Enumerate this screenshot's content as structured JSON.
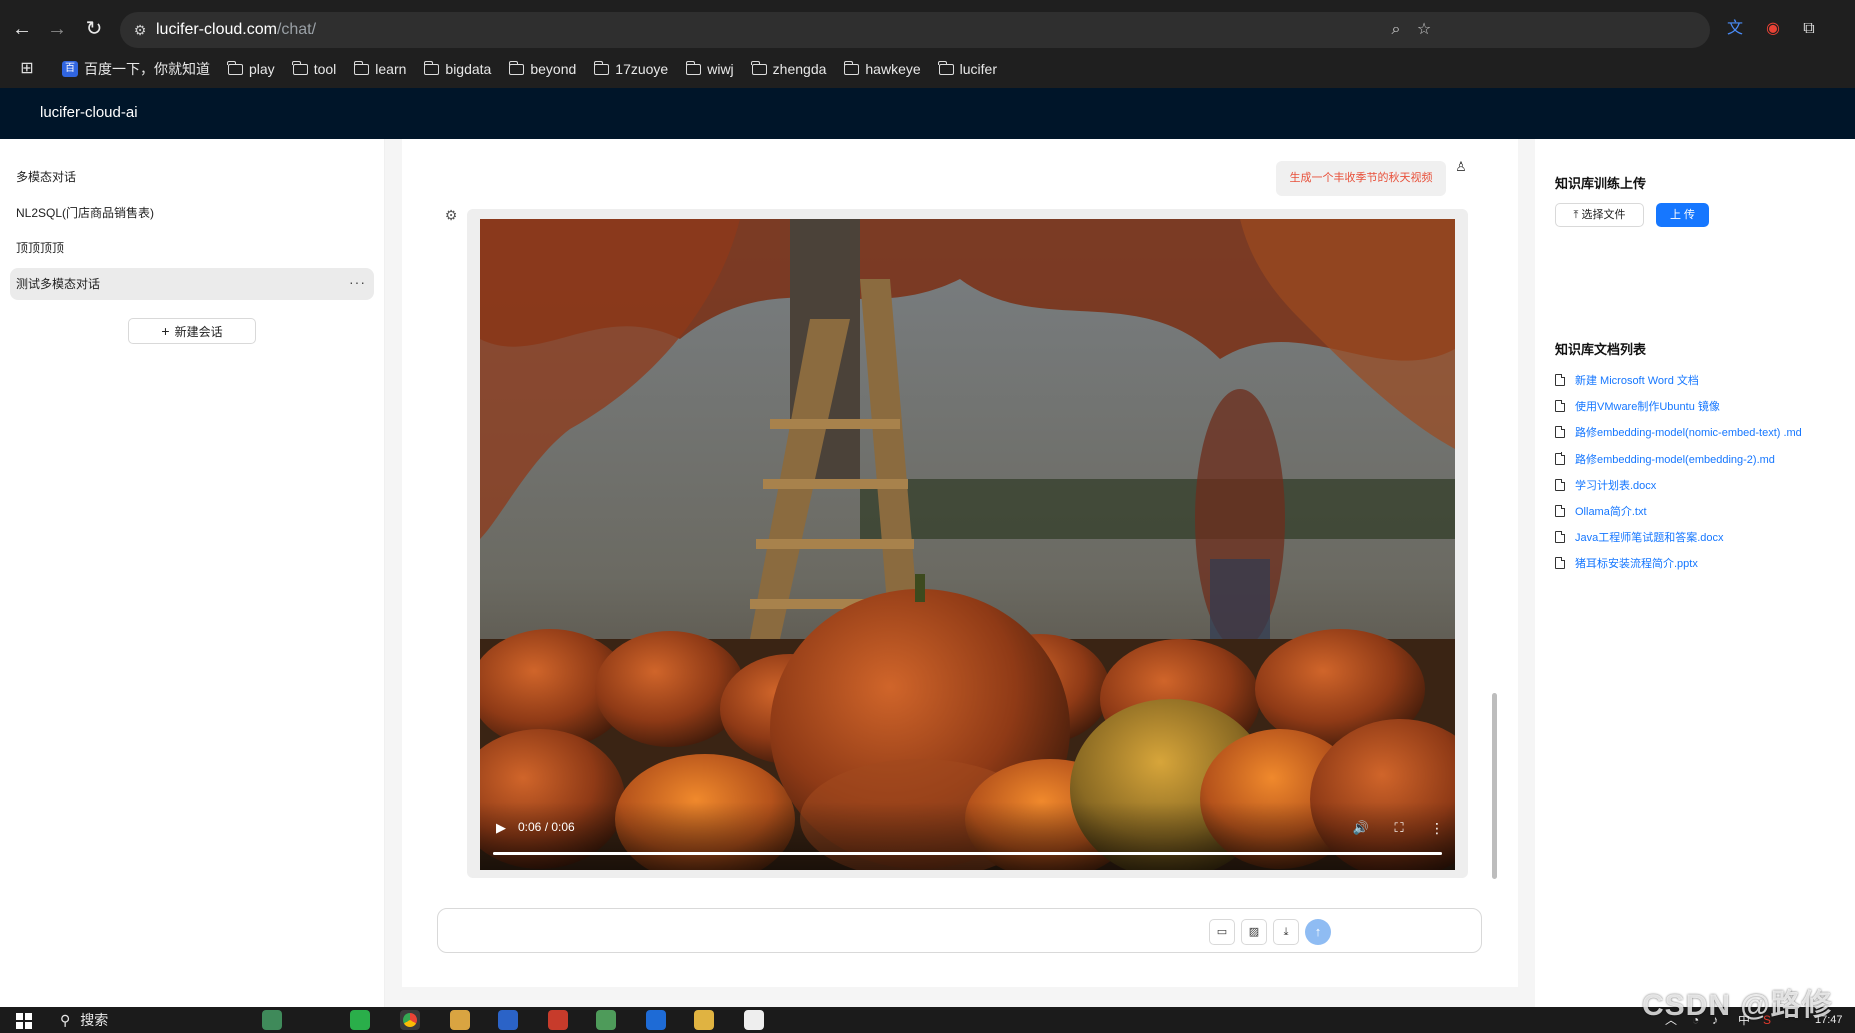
{
  "browser": {
    "url_host": "lucifer-cloud.com",
    "url_path": "/chat/",
    "bookmarks": [
      {
        "label": "百度一下，你就知道",
        "icon": "baidu-icon"
      },
      {
        "label": "play",
        "icon": "folder-icon"
      },
      {
        "label": "tool",
        "icon": "folder-icon"
      },
      {
        "label": "learn",
        "icon": "folder-icon"
      },
      {
        "label": "bigdata",
        "icon": "folder-icon"
      },
      {
        "label": "beyond",
        "icon": "folder-icon"
      },
      {
        "label": "17zuoye",
        "icon": "folder-icon"
      },
      {
        "label": "wiwj",
        "icon": "folder-icon"
      },
      {
        "label": "zhengda",
        "icon": "folder-icon"
      },
      {
        "label": "hawkeye",
        "icon": "folder-icon"
      },
      {
        "label": "lucifer",
        "icon": "folder-icon"
      }
    ]
  },
  "app": {
    "title": "lucifer-cloud-ai"
  },
  "sidebar": {
    "conversations": [
      {
        "label": "多模态对话"
      },
      {
        "label": "NL2SQL(门店商品销售表)"
      },
      {
        "label": "顶顶顶顶"
      },
      {
        "label": "测试多模态对话",
        "active": true
      }
    ],
    "more_label": "···",
    "new_conversation_label": "新建会话"
  },
  "chat": {
    "user_message": "生成一个丰收季节的秋天视频",
    "video": {
      "time_display": "0:06 / 0:06",
      "progress": 1.0
    },
    "input": {
      "value": "",
      "placeholder": ""
    }
  },
  "knowledge": {
    "upload_title": "知识库训练上传",
    "select_file_label": "选择文件",
    "upload_label": "上 传",
    "list_title": "知识库文档列表",
    "documents": [
      "新建 Microsoft Word 文档",
      "使用VMware制作Ubuntu 镜像",
      "路修embedding-model(nomic-embed-text) .md",
      "路修embedding-model(embedding-2).md",
      "学习计划表.docx",
      "Ollama简介.txt",
      "Java工程师笔试题和答案.docx",
      "猪耳标安装流程简介.pptx"
    ]
  },
  "taskbar": {
    "search_label": "搜索",
    "ime_label": "中",
    "clock": "17:47"
  },
  "watermark": "CSDN @路修",
  "colors": {
    "header_bg": "#001529",
    "accent": "#1677ff",
    "user_message_text": "#e8503a",
    "send_button": "#8fbcf3"
  }
}
